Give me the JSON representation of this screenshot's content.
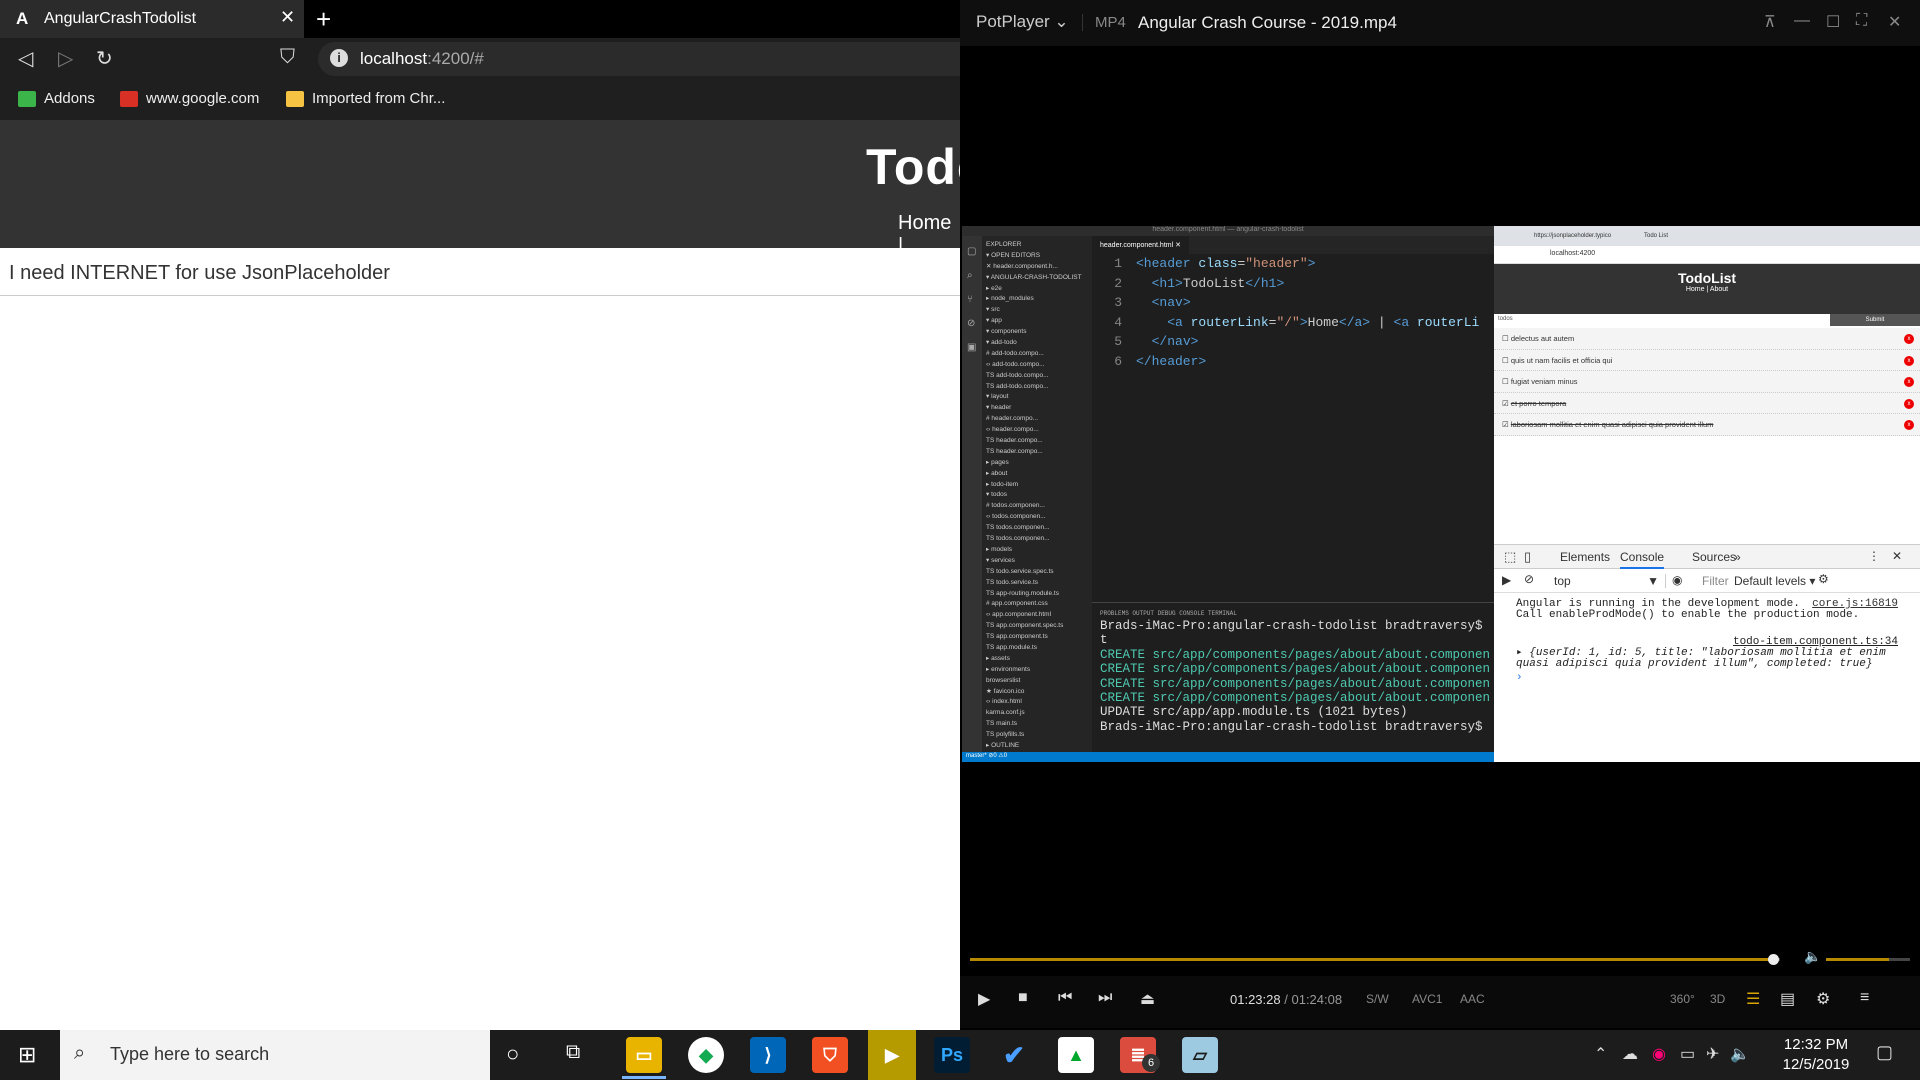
{
  "browser": {
    "tab_icon": "A",
    "tab_title": "AngularCrashTodolist",
    "close_tab": "✕",
    "new_tab": "+",
    "url_host": "localhost",
    "url_rest": ":4200/#",
    "bookmarks": [
      {
        "label": "Addons",
        "icon": "puzzle-icon",
        "color": "#3bb54a"
      },
      {
        "label": "www.google.com",
        "icon": "gmail-icon",
        "color": "#d93025"
      },
      {
        "label": "Imported from Chr...",
        "icon": "folder-icon",
        "color": "#f6c342"
      }
    ],
    "app_title": "Todo",
    "app_nav": "Home |",
    "message": "I need INTERNET for use JsonPlaceholder"
  },
  "player": {
    "brand": "PotPlayer",
    "format": "MP4",
    "filename": "Angular Crash Course - 2019.mp4",
    "time_current": "01:23:28",
    "time_sep": "/",
    "time_total": "01:24:08",
    "codecs": [
      "S/W",
      "AVC1",
      "AAC"
    ],
    "progress_fraction": 0.992,
    "volume_fraction": 0.75,
    "badges": [
      "360°",
      "3D"
    ]
  },
  "video": {
    "vscode_title": "header.component.html — angular-crash-todolist",
    "explorer": [
      "EXPLORER",
      "▾ OPEN EDITORS",
      "  ✕  header.component.h...",
      "▾ ANGULAR-CRASH-TODOLIST",
      "  ▸ e2e",
      "  ▸ node_modules",
      "  ▾ src",
      "    ▾ app",
      "      ▾ components",
      "        ▾ add-todo",
      "          # add-todo.compo...",
      "          ‹› add-todo.compo...",
      "          TS add-todo.compo...",
      "          TS add-todo.compo...",
      "        ▾ layout",
      "          ▾ header",
      "            # header.compo...",
      "            ‹› header.compo...",
      "            TS header.compo...",
      "            TS header.compo...",
      "        ▸ pages",
      "          ▸ about",
      "        ▸ todo-item",
      "        ▾ todos",
      "          # todos.componen...",
      "          ‹› todos.componen...",
      "          TS todos.componen...",
      "          TS todos.componen...",
      "      ▸ models",
      "      ▾ services",
      "        TS todo.service.spec.ts",
      "        TS todo.service.ts",
      "      TS app-routing.module.ts",
      "      # app.component.css",
      "      ‹› app.component.html",
      "      TS app.component.spec.ts",
      "      TS app.component.ts",
      "      TS app.module.ts",
      "    ▸ assets",
      "    ▸ environments",
      "      browserslist",
      "    ★ favicon.ico",
      "    ‹› index.html",
      "      karma.conf.js",
      "    TS main.ts",
      "    TS polyfills.ts",
      "▸ OUTLINE"
    ],
    "editor_tab": "header.component.html ✕",
    "code": [
      {
        "n": "1",
        "parts": [
          [
            "tg",
            "<header "
          ],
          [
            "at",
            "class"
          ],
          [
            "",
            "="
          ],
          [
            "sv",
            "\"header\""
          ],
          [
            "tg",
            ">"
          ]
        ]
      },
      {
        "n": "2",
        "parts": [
          [
            "",
            "  "
          ],
          [
            "tg",
            "<h1>"
          ],
          [
            "",
            "TodoList"
          ],
          [
            "tg",
            "</h1>"
          ]
        ]
      },
      {
        "n": "3",
        "parts": [
          [
            "",
            "  "
          ],
          [
            "tg",
            "<nav>"
          ]
        ]
      },
      {
        "n": "4",
        "parts": [
          [
            "",
            "    "
          ],
          [
            "tg",
            "<a "
          ],
          [
            "at",
            "routerLink"
          ],
          [
            "",
            "="
          ],
          [
            "sv",
            "\"/\""
          ],
          [
            "tg",
            ">"
          ],
          [
            "",
            "Home"
          ],
          [
            "tg",
            "</a>"
          ],
          [
            "",
            " | "
          ],
          [
            "tg",
            "<a "
          ],
          [
            "at",
            "routerLi"
          ]
        ]
      },
      {
        "n": "5",
        "parts": [
          [
            "",
            "  "
          ],
          [
            "tg",
            "</nav>"
          ]
        ]
      },
      {
        "n": "6",
        "parts": [
          [
            "tg",
            "</header>"
          ]
        ]
      }
    ],
    "term_tabs": "PROBLEMS    OUTPUT    DEBUG CONSOLE    TERMINAL",
    "terminal": [
      {
        "c": "",
        "t": "Brads-iMac-Pro:angular-crash-todolist bradtraversy$"
      },
      {
        "c": "",
        "t": "t"
      },
      {
        "c": "cr",
        "t": "CREATE src/app/components/pages/about/about.componen"
      },
      {
        "c": "cr",
        "t": "CREATE src/app/components/pages/about/about.componen"
      },
      {
        "c": "cr",
        "t": "CREATE src/app/components/pages/about/about.componen"
      },
      {
        "c": "cr",
        "t": "CREATE src/app/components/pages/about/about.componen"
      },
      {
        "c": "",
        "t": "UPDATE src/app/app.module.ts (1021 bytes)"
      },
      {
        "c": "",
        "t": "Brads-iMac-Pro:angular-crash-todolist bradtraversy$"
      }
    ],
    "status": "master* ⊘0 ⚠0",
    "c2": {
      "tab1": "https://jsonplaceholder.typico",
      "tab2": "Todo List",
      "url": "localhost:4200",
      "title": "TodoList",
      "nav": "Home | About",
      "input": "todos",
      "submit": "Submit",
      "todos": [
        {
          "t": "delectus aut autem",
          "done": false
        },
        {
          "t": "quis ut nam facilis et officia qui",
          "done": false
        },
        {
          "t": "fugiat veniam minus",
          "done": false
        },
        {
          "t": "et porro tempora",
          "done": true
        },
        {
          "t": "laboriosam mollitia et enim quasi adipisci quia provident illum",
          "done": true
        }
      ]
    },
    "devtools": {
      "tabs": [
        "Elements",
        "Console",
        "Sources",
        "»"
      ],
      "context": "top",
      "filter": "Filter",
      "levels": "Default levels ▾",
      "msg1": "Angular is running in the development mode. Call enableProdMode() to enable the production mode.",
      "link1": "core.js:16819",
      "link2": "todo-item.component.ts:34",
      "msg2": "▸ {userId: 1, id: 5, title: \"laboriosam mollitia et enim quasi adipisci quia provident illum\", completed: true}",
      "prompt": "›"
    }
  },
  "taskbar": {
    "search_placeholder": "Type here to search",
    "time": "12:32 PM",
    "date": "12/5/2019",
    "badge": "6"
  }
}
